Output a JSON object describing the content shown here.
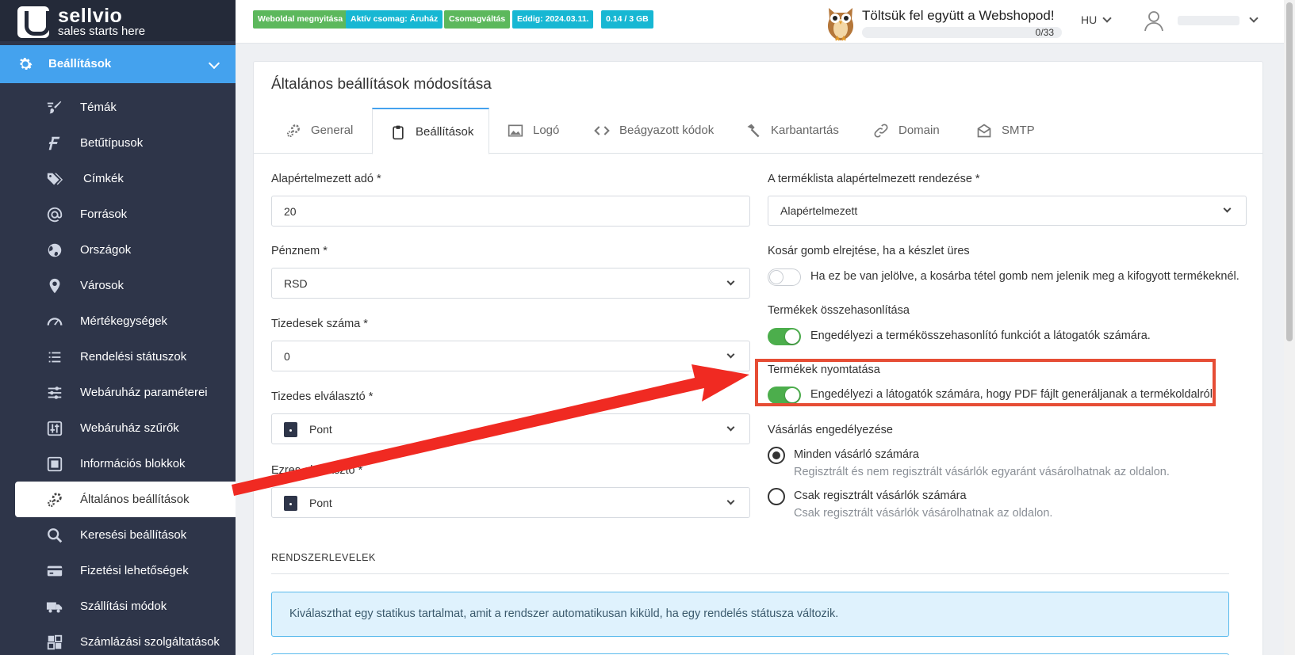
{
  "brand": {
    "name": "sellvio",
    "tagline": "sales starts here"
  },
  "sidebar": {
    "section": {
      "label": "Beállítások",
      "icon": "gear-icon"
    },
    "items": [
      {
        "label": "Témák",
        "icon": "paint-brush-icon"
      },
      {
        "label": "Betűtípusok",
        "icon": "font-icon"
      },
      {
        "label": "Címkék",
        "icon": "tags-icon"
      },
      {
        "label": "Források",
        "icon": "at-icon"
      },
      {
        "label": "Országok",
        "icon": "globe-icon"
      },
      {
        "label": "Városok",
        "icon": "map-pin-icon"
      },
      {
        "label": "Mértékegységek",
        "icon": "gauge-icon"
      },
      {
        "label": "Rendelési státuszok",
        "icon": "list-icon"
      },
      {
        "label": "Webáruház paraméterei",
        "icon": "sliders-icon"
      },
      {
        "label": "Webáruház szűrők",
        "icon": "filter-sliders-icon"
      },
      {
        "label": "Információs blokkok",
        "icon": "info-block-icon"
      },
      {
        "label": "Általános beállítások",
        "icon": "cogs-icon",
        "active": true
      },
      {
        "label": "Keresési beállítások",
        "icon": "search-icon"
      },
      {
        "label": "Fizetési lehetőségek",
        "icon": "credit-card-icon"
      },
      {
        "label": "Szállítási módok",
        "icon": "truck-icon"
      },
      {
        "label": "Számlázási szolgáltatások",
        "icon": "invoice-icon"
      }
    ]
  },
  "topbar": {
    "badges": [
      {
        "label": "Weboldal megnyitása",
        "color": "#5cb85c"
      },
      {
        "label": "Aktív csomag: Áruház",
        "color": "#17b7d3"
      },
      {
        "label": "Csomagváltás",
        "color": "#5cb85c"
      },
      {
        "label": "Eddig: 2024.03.11.",
        "color": "#17b7d3"
      },
      {
        "label": "0.14 / 3 GB",
        "color": "#17b7d3"
      }
    ],
    "promo_title": "Töltsük fel együtt a Webshopod!",
    "promo_progress": "0/33",
    "language": "HU"
  },
  "card": {
    "title": "Általános beállítások módosítása",
    "tabs": [
      {
        "label": "General",
        "icon": "cogs-icon"
      },
      {
        "label": "Beállítások",
        "icon": "clipboard-icon",
        "active": true
      },
      {
        "label": "Logó",
        "icon": "image-icon"
      },
      {
        "label": "Beágyazott kódok",
        "icon": "code-icon"
      },
      {
        "label": "Karbantartás",
        "icon": "hammer-icon"
      },
      {
        "label": "Domain",
        "icon": "link-icon"
      },
      {
        "label": "SMTP",
        "icon": "envelope-icon"
      }
    ],
    "left": {
      "tax_label": "Alapértelmezett adó *",
      "tax_value": "20",
      "currency_label": "Pénznem *",
      "currency_value": "RSD",
      "decimals_label": "Tizedesek száma *",
      "decimals_value": "0",
      "decimal_sep_label": "Tizedes elválasztó *",
      "decimal_sep_value": "Pont",
      "thousand_sep_label": "Ezres elválasztó *",
      "thousand_sep_value": "Pont"
    },
    "right": {
      "sort_label": "A terméklista alapértelmezett rendezése *",
      "sort_value": "Alapértelmezett",
      "cart_label": "Kosár gomb elrejtése, ha a készlet üres",
      "cart_text": "Ha ez be van jelölve, a kosárba tétel gomb nem jelenik meg a kifogyott termékeknél.",
      "cart_on": false,
      "compare_label": "Termékek összehasonlítása",
      "compare_text": "Engedélyezi a termékösszehasonlító funkciót a látogatók számára.",
      "compare_on": true,
      "print_label": "Termékek nyomtatása",
      "print_text": "Engedélyezi a látogatók számára, hogy PDF fájlt generáljanak a termékoldalról.",
      "print_on": true,
      "purchase_label": "Vásárlás engedélyezése",
      "purchase_all_label": "Minden vásárló számára",
      "purchase_all_help": "Regisztrált és nem regisztrált vásárlók egyaránt vásárolhatnak az oldalon.",
      "purchase_reg_label": "Csak regisztrált vásárlók számára",
      "purchase_reg_help": "Csak regisztrált vásárlók vásárolhatnak az oldalon.",
      "purchase_selected": "all"
    },
    "system_emails_title": "RENDSZERLEVELEK",
    "info_text": "Kiválaszthat egy statikus tartalmat, amit a rendszer automatikusan kiküld, ha egy rendelés státusza változik."
  },
  "annotation": {
    "color": "#e64d35"
  }
}
